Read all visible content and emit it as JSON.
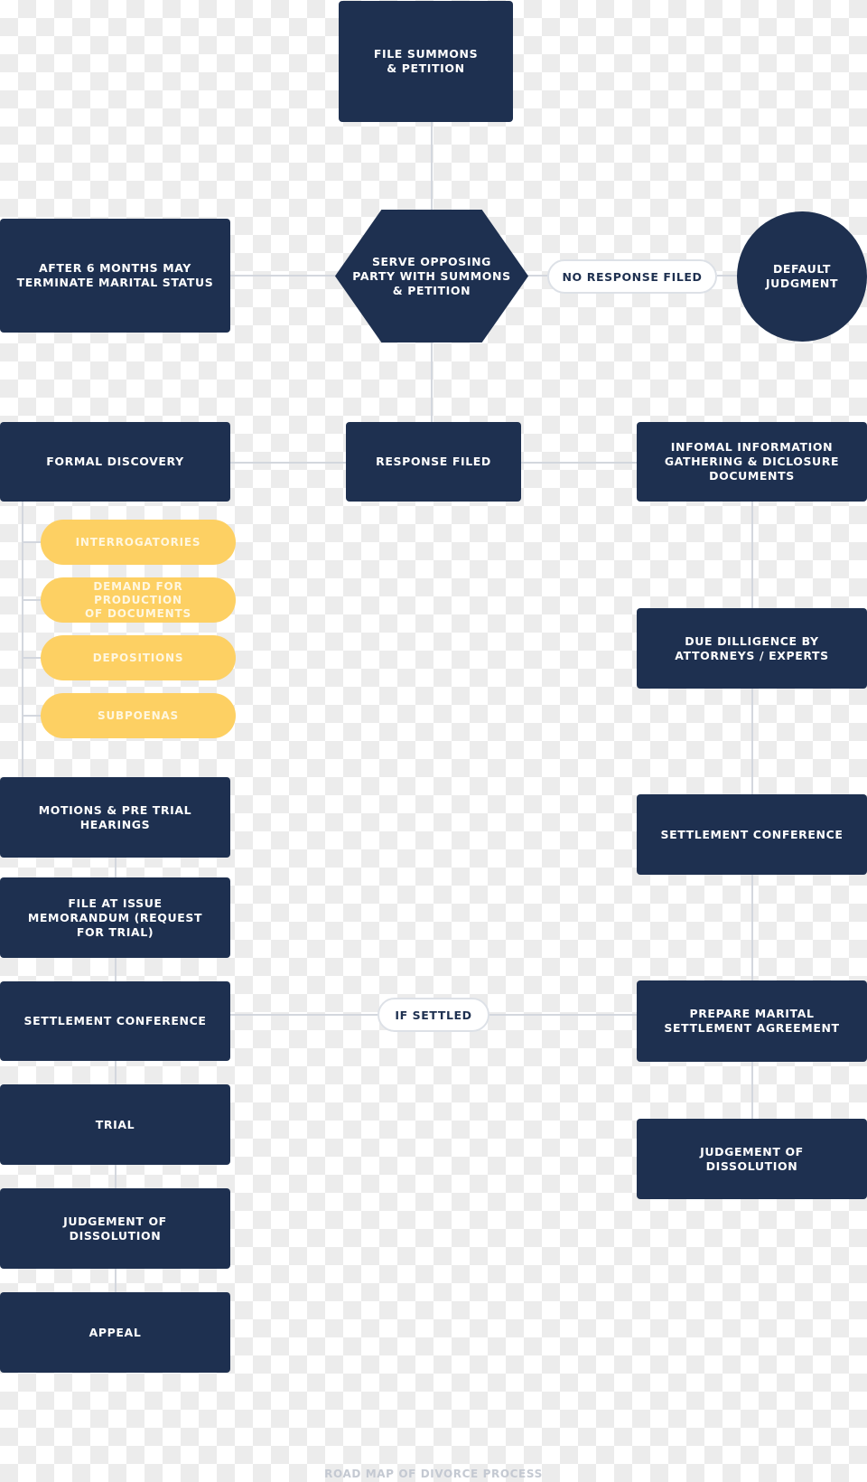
{
  "title": "ROAD MAP OF DIVORCE PROCESS",
  "colors": {
    "node": "#1e3050",
    "sub_step": "#fdd063",
    "connector": "#d3d7de",
    "label_pill_border": "#dde1e7"
  },
  "center": {
    "file_summons": "FILE SUMMONS\n& PETITION",
    "serve": "SERVE OPPOSING\nPARTY WITH SUMMONS\n& PETITION",
    "response_filed": "RESPONSE FILED"
  },
  "branches": {
    "no_response_label": "NO RESPONSE FILED",
    "default_judgment": "DEFAULT\nJUDGMENT",
    "after_six_months": "AFTER 6 MONTHS MAY\nTERMINATE MARITAL STATUS",
    "if_settled_label": "IF SETTLED"
  },
  "left_track": {
    "formal_discovery": "FORMAL DISCOVERY",
    "discovery_items": [
      "INTERROGATORIES",
      "DEMAND FOR PRODUCTION\nOF DOCUMENTS",
      "DEPOSITIONS",
      "SUBPOENAS"
    ],
    "steps": [
      "MOTIONS & PRE TRIAL\nHEARINGS",
      "FILE AT ISSUE\nMEMORANDUM (REQUEST\nFOR TRIAL)",
      "SETTLEMENT CONFERENCE",
      "TRIAL",
      "JUDGEMENT OF\nDISSOLUTION",
      "APPEAL"
    ]
  },
  "right_track": {
    "steps": [
      "INFOMAL INFORMATION\nGATHERING & DICLOSURE\nDOCUMENTS",
      "DUE DILLIGENCE BY\nATTORNEYS / EXPERTS",
      "SETTLEMENT CONFERENCE",
      "PREPARE MARITAL\nSETTLEMENT AGREEMENT",
      "JUDGEMENT OF\nDISSOLUTION"
    ]
  }
}
